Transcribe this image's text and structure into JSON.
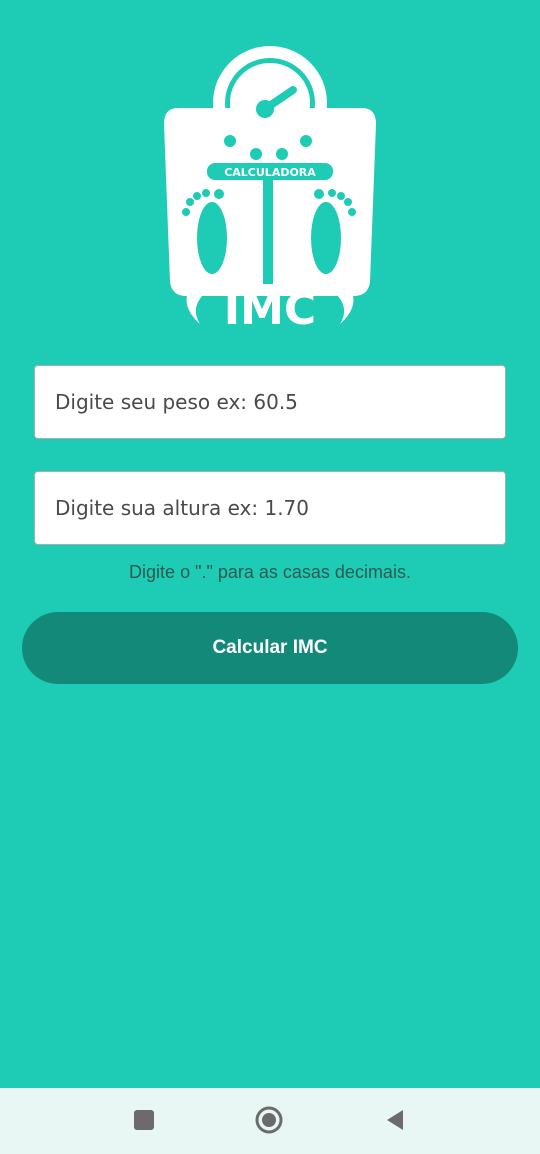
{
  "logo": {
    "top_text": "CALCULADORA",
    "main_text": "IMC",
    "icon": "scale-icon"
  },
  "form": {
    "weight_placeholder": "Digite seu peso ex: 60.5",
    "height_placeholder": "Digite sua altura ex: 1.70",
    "hint": "Digite o \".\" para as casas decimais.",
    "button_label": "Calcular IMC"
  },
  "navbar": {
    "recents_icon": "square-icon",
    "home_icon": "circle-home-icon",
    "back_icon": "triangle-back-icon"
  },
  "colors": {
    "background": "#1ecbb4",
    "button": "#138a79",
    "navbar": "#e9f7f4"
  }
}
